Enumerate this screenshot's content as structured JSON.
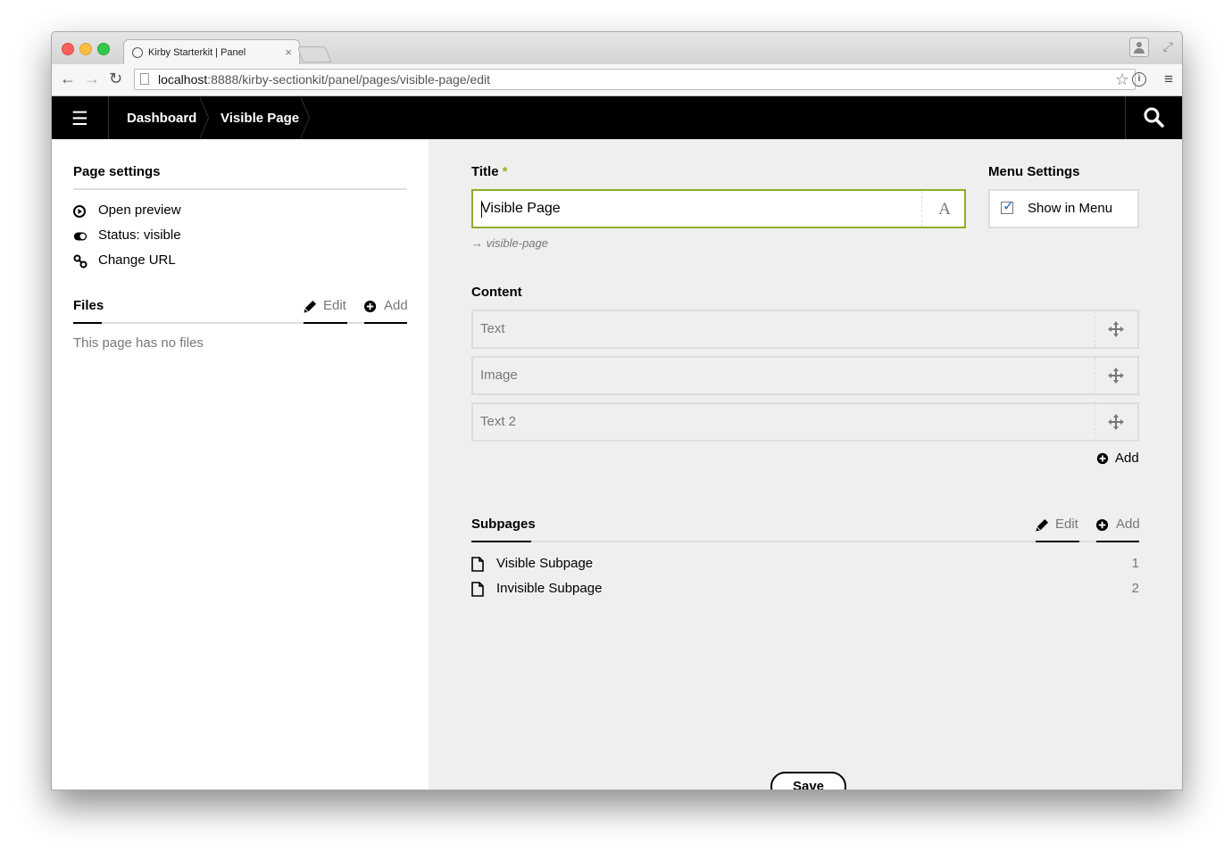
{
  "browser": {
    "tab_title": "Kirby Starterkit | Panel",
    "tab_close": "×",
    "url_host": "localhost",
    "url_rest": ":8888/kirby-sectionkit/panel/pages/visible-page/edit",
    "icons": [
      "back-icon",
      "forward-icon",
      "reload-icon",
      "page-icon",
      "star-icon",
      "info-icon",
      "menu-icon",
      "profile-icon",
      "fullscreen-icon"
    ]
  },
  "topbar": {
    "breadcrumbs": [
      "Dashboard",
      "Visible Page"
    ]
  },
  "sidebar": {
    "page_settings_title": "Page settings",
    "items": [
      "Open preview",
      "Status: visible",
      "Change URL"
    ],
    "files_title": "Files",
    "files_edit": "Edit",
    "files_add": "Add",
    "files_empty": "This page has no files"
  },
  "form": {
    "title_label": "Title",
    "title_required": "*",
    "title_value": "Visible Page",
    "slug": "visible-page",
    "menu_label": "Menu Settings",
    "menu_checkbox_label": "Show in Menu",
    "menu_checked": true,
    "content_label": "Content",
    "blocks": [
      "Text",
      "Image",
      "Text 2"
    ],
    "content_add": "Add",
    "subpages_title": "Subpages",
    "subpages_edit": "Edit",
    "subpages_add": "Add",
    "subpages": [
      {
        "title": "Visible Subpage",
        "num": "1"
      },
      {
        "title": "Invisible Subpage",
        "num": "2"
      }
    ],
    "save_label": "Save"
  },
  "colors": {
    "accent": "#8dae28",
    "topbar": "#000000",
    "main_bg": "#efefef",
    "muted_text": "#777777"
  }
}
